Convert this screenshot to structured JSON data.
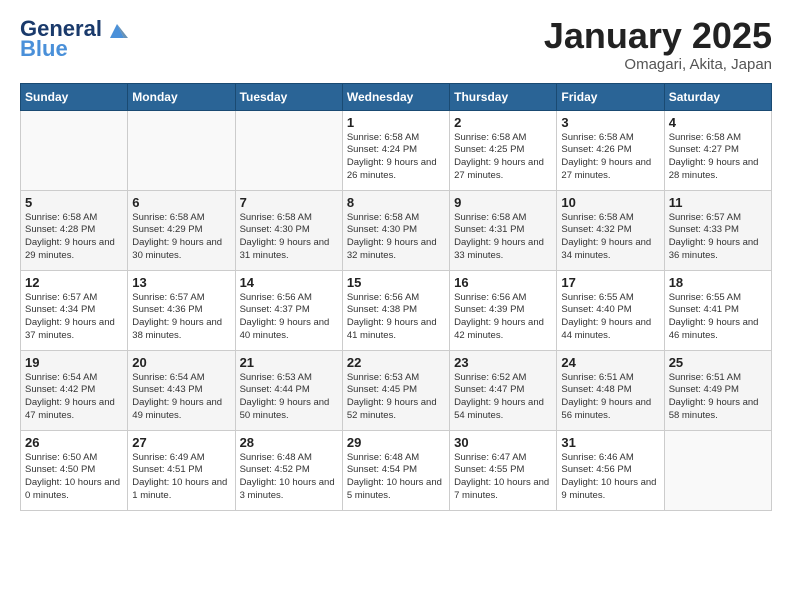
{
  "header": {
    "logo_general": "General",
    "logo_blue": "Blue",
    "title": "January 2025",
    "subtitle": "Omagari, Akita, Japan"
  },
  "days_of_week": [
    "Sunday",
    "Monday",
    "Tuesday",
    "Wednesday",
    "Thursday",
    "Friday",
    "Saturday"
  ],
  "weeks": [
    [
      {
        "day": "",
        "info": ""
      },
      {
        "day": "",
        "info": ""
      },
      {
        "day": "",
        "info": ""
      },
      {
        "day": "1",
        "info": "Sunrise: 6:58 AM\nSunset: 4:24 PM\nDaylight: 9 hours\nand 26 minutes."
      },
      {
        "day": "2",
        "info": "Sunrise: 6:58 AM\nSunset: 4:25 PM\nDaylight: 9 hours\nand 27 minutes."
      },
      {
        "day": "3",
        "info": "Sunrise: 6:58 AM\nSunset: 4:26 PM\nDaylight: 9 hours\nand 27 minutes."
      },
      {
        "day": "4",
        "info": "Sunrise: 6:58 AM\nSunset: 4:27 PM\nDaylight: 9 hours\nand 28 minutes."
      }
    ],
    [
      {
        "day": "5",
        "info": "Sunrise: 6:58 AM\nSunset: 4:28 PM\nDaylight: 9 hours\nand 29 minutes."
      },
      {
        "day": "6",
        "info": "Sunrise: 6:58 AM\nSunset: 4:29 PM\nDaylight: 9 hours\nand 30 minutes."
      },
      {
        "day": "7",
        "info": "Sunrise: 6:58 AM\nSunset: 4:30 PM\nDaylight: 9 hours\nand 31 minutes."
      },
      {
        "day": "8",
        "info": "Sunrise: 6:58 AM\nSunset: 4:30 PM\nDaylight: 9 hours\nand 32 minutes."
      },
      {
        "day": "9",
        "info": "Sunrise: 6:58 AM\nSunset: 4:31 PM\nDaylight: 9 hours\nand 33 minutes."
      },
      {
        "day": "10",
        "info": "Sunrise: 6:58 AM\nSunset: 4:32 PM\nDaylight: 9 hours\nand 34 minutes."
      },
      {
        "day": "11",
        "info": "Sunrise: 6:57 AM\nSunset: 4:33 PM\nDaylight: 9 hours\nand 36 minutes."
      }
    ],
    [
      {
        "day": "12",
        "info": "Sunrise: 6:57 AM\nSunset: 4:34 PM\nDaylight: 9 hours\nand 37 minutes."
      },
      {
        "day": "13",
        "info": "Sunrise: 6:57 AM\nSunset: 4:36 PM\nDaylight: 9 hours\nand 38 minutes."
      },
      {
        "day": "14",
        "info": "Sunrise: 6:56 AM\nSunset: 4:37 PM\nDaylight: 9 hours\nand 40 minutes."
      },
      {
        "day": "15",
        "info": "Sunrise: 6:56 AM\nSunset: 4:38 PM\nDaylight: 9 hours\nand 41 minutes."
      },
      {
        "day": "16",
        "info": "Sunrise: 6:56 AM\nSunset: 4:39 PM\nDaylight: 9 hours\nand 42 minutes."
      },
      {
        "day": "17",
        "info": "Sunrise: 6:55 AM\nSunset: 4:40 PM\nDaylight: 9 hours\nand 44 minutes."
      },
      {
        "day": "18",
        "info": "Sunrise: 6:55 AM\nSunset: 4:41 PM\nDaylight: 9 hours\nand 46 minutes."
      }
    ],
    [
      {
        "day": "19",
        "info": "Sunrise: 6:54 AM\nSunset: 4:42 PM\nDaylight: 9 hours\nand 47 minutes."
      },
      {
        "day": "20",
        "info": "Sunrise: 6:54 AM\nSunset: 4:43 PM\nDaylight: 9 hours\nand 49 minutes."
      },
      {
        "day": "21",
        "info": "Sunrise: 6:53 AM\nSunset: 4:44 PM\nDaylight: 9 hours\nand 50 minutes."
      },
      {
        "day": "22",
        "info": "Sunrise: 6:53 AM\nSunset: 4:45 PM\nDaylight: 9 hours\nand 52 minutes."
      },
      {
        "day": "23",
        "info": "Sunrise: 6:52 AM\nSunset: 4:47 PM\nDaylight: 9 hours\nand 54 minutes."
      },
      {
        "day": "24",
        "info": "Sunrise: 6:51 AM\nSunset: 4:48 PM\nDaylight: 9 hours\nand 56 minutes."
      },
      {
        "day": "25",
        "info": "Sunrise: 6:51 AM\nSunset: 4:49 PM\nDaylight: 9 hours\nand 58 minutes."
      }
    ],
    [
      {
        "day": "26",
        "info": "Sunrise: 6:50 AM\nSunset: 4:50 PM\nDaylight: 10 hours\nand 0 minutes."
      },
      {
        "day": "27",
        "info": "Sunrise: 6:49 AM\nSunset: 4:51 PM\nDaylight: 10 hours\nand 1 minute."
      },
      {
        "day": "28",
        "info": "Sunrise: 6:48 AM\nSunset: 4:52 PM\nDaylight: 10 hours\nand 3 minutes."
      },
      {
        "day": "29",
        "info": "Sunrise: 6:48 AM\nSunset: 4:54 PM\nDaylight: 10 hours\nand 5 minutes."
      },
      {
        "day": "30",
        "info": "Sunrise: 6:47 AM\nSunset: 4:55 PM\nDaylight: 10 hours\nand 7 minutes."
      },
      {
        "day": "31",
        "info": "Sunrise: 6:46 AM\nSunset: 4:56 PM\nDaylight: 10 hours\nand 9 minutes."
      },
      {
        "day": "",
        "info": ""
      }
    ]
  ]
}
